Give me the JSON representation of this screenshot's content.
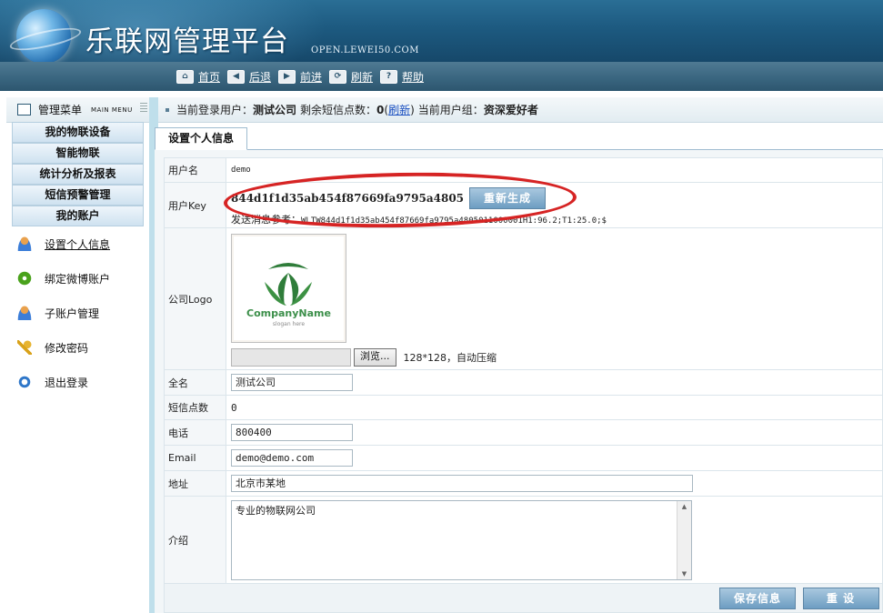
{
  "header": {
    "title": "乐联网管理平台",
    "url": "OPEN.LEWEI50.COM"
  },
  "nav": [
    {
      "label": "首页",
      "icon": "home-icon"
    },
    {
      "label": "后退",
      "icon": "back-icon"
    },
    {
      "label": "前进",
      "icon": "forward-icon"
    },
    {
      "label": "刷新",
      "icon": "refresh-icon"
    },
    {
      "label": "帮助",
      "icon": "help-icon"
    }
  ],
  "sidebar": {
    "title": "管理菜单",
    "title_en": "MAIN MENU",
    "categories": [
      "我的物联设备",
      "智能物联",
      "统计分析及报表",
      "短信预警管理",
      "我的账户"
    ],
    "items": [
      {
        "label": "设置个人信息",
        "icon": "user-icon"
      },
      {
        "label": "绑定微博账户",
        "icon": "weibo-icon"
      },
      {
        "label": "子账户管理",
        "icon": "user-icon"
      },
      {
        "label": "修改密码",
        "icon": "key-icon"
      },
      {
        "label": "退出登录",
        "icon": "exit-icon"
      }
    ]
  },
  "status": {
    "login_label": "当前登录用户：",
    "user": "测试公司",
    "sms_label": "剩余短信点数：",
    "sms_count": "0",
    "refresh": "刷新",
    "group_label": "当前用户组：",
    "group": "资深爱好者"
  },
  "tab": {
    "active": "设置个人信息"
  },
  "form": {
    "username_label": "用户名",
    "username": "demo",
    "userkey_label": "用户Key",
    "userkey": "844d1f1d35ab454f87669fa9795a4805",
    "regenerate": "重新生成",
    "msg_ref_label": "发送消息参考：",
    "msg_ref": "WLTW844d1f1d35ab454f87669fa9795a4805011000001H1:96.2;T1:25.0;$",
    "logo_label": "公司Logo",
    "logo_company": "CompanyName",
    "logo_slogan": "slogan here",
    "browse": "浏览...",
    "logo_hint": "128*128，自动压缩",
    "fullname_label": "全名",
    "fullname": "测试公司",
    "sms_label": "短信点数",
    "sms": "0",
    "phone_label": "电话",
    "phone": "800400",
    "email_label": "Email",
    "email": "demo@demo.com",
    "address_label": "地址",
    "address": "北京市某地",
    "intro_label": "介绍",
    "intro": "专业的物联网公司",
    "save": "保存信息",
    "reset": "重 设"
  },
  "colors": {
    "highlight_ellipse": "#d62424",
    "header_bg": "#1d5a80",
    "sidebar_border": "#bfdfeb"
  }
}
